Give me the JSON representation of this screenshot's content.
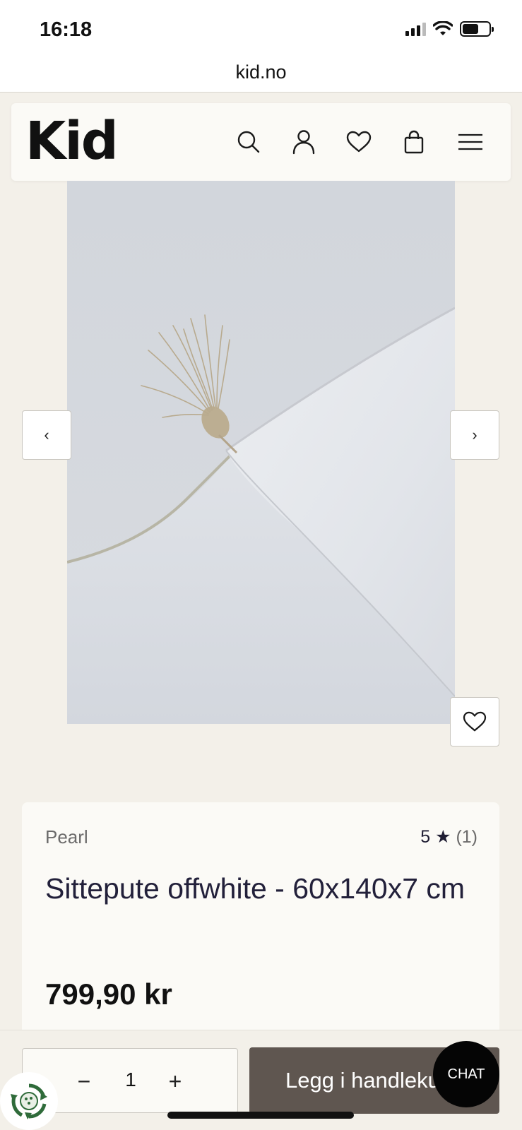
{
  "status_bar": {
    "time": "16:18"
  },
  "browser": {
    "url": "kid.no"
  },
  "header": {
    "logo": "Kid",
    "icons": [
      "search-icon",
      "account-icon",
      "wishlist-icon",
      "cart-icon",
      "menu-icon"
    ]
  },
  "gallery": {
    "prev_label": "‹",
    "next_label": "›"
  },
  "product": {
    "brand": "Pearl",
    "rating_value": "5 ★",
    "rating_count": "(1)",
    "title": "Sittepute offwhite - 60x140x7 cm",
    "price": "799,90 kr"
  },
  "purchase": {
    "quantity": "1",
    "minus_label": "−",
    "plus_label": "+",
    "add_to_cart_label": "Legg i handlekurv"
  },
  "chat": {
    "label": "CHAT"
  },
  "colors": {
    "page_bg": "#f3f0e9",
    "card_bg": "#fbfaf6",
    "cta_bg": "#5f5650",
    "chat_bg": "#050505",
    "eco_green": "#2f6b3a"
  }
}
